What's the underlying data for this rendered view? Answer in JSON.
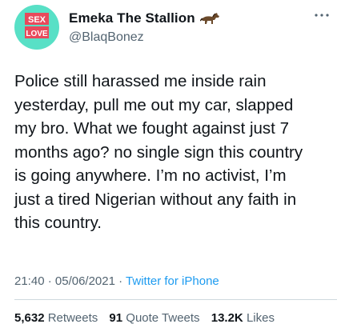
{
  "author": {
    "display_name": "Emeka The Stallion",
    "handle": "@BlaqBonez",
    "name_emoji_icon": "horse-icon",
    "avatar_text": [
      "SEX",
      "LOVE"
    ],
    "avatar_color": "#58e0c6"
  },
  "tweet": {
    "lines": [
      "Police still harassed me inside rain",
      "yesterday, pull me out my car, slapped",
      "my bro. What we fought against just 7",
      "months ago? no single sign this country",
      "is going anywhere. I’m no activist, I’m",
      "just a tired Nigerian without any faith in",
      "this country."
    ]
  },
  "meta": {
    "time": "21:40",
    "date": "05/06/2021",
    "separator": "·",
    "source": "Twitter for iPhone"
  },
  "stats": {
    "retweets_count": "5,632",
    "retweets_label": "Retweets",
    "quotes_count": "91",
    "quotes_label": "Quote Tweets",
    "likes_count": "13.2K",
    "likes_label": "Likes"
  },
  "colors": {
    "text": "#0f1419",
    "secondary": "#536471",
    "link": "#1d9bf0",
    "divider": "#cfd9de"
  }
}
